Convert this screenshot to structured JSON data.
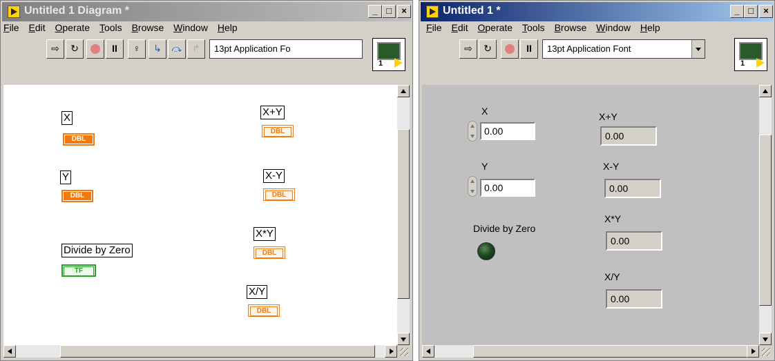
{
  "diagram_window": {
    "title": "Untitled 1 Diagram *",
    "menu": [
      "File",
      "Edit",
      "Operate",
      "Tools",
      "Browse",
      "Window",
      "Help"
    ],
    "font": "13pt Application Fo",
    "icon_number": "1",
    "controls": [
      {
        "label": "X",
        "type": "DBL"
      },
      {
        "label": "Y",
        "type": "DBL"
      },
      {
        "label": "Divide by Zero",
        "type": "TF"
      }
    ],
    "indicators": [
      {
        "label": "X+Y",
        "type": "DBL"
      },
      {
        "label": "X-Y",
        "type": "DBL"
      },
      {
        "label": "X*Y",
        "type": "DBL"
      },
      {
        "label": "X/Y",
        "type": "DBL"
      }
    ]
  },
  "panel_window": {
    "title": "Untitled 1 *",
    "menu": [
      "File",
      "Edit",
      "Operate",
      "Tools",
      "Browse",
      "Window",
      "Help"
    ],
    "font": "13pt Application Font",
    "icon_number": "1",
    "controls": [
      {
        "label": "X",
        "value": "0.00"
      },
      {
        "label": "Y",
        "value": "0.00"
      }
    ],
    "led_label": "Divide by Zero",
    "indicators": [
      {
        "label": "X+Y",
        "value": "0.00"
      },
      {
        "label": "X-Y",
        "value": "0.00"
      },
      {
        "label": "X*Y",
        "value": "0.00"
      },
      {
        "label": "X/Y",
        "value": "0.00"
      }
    ]
  },
  "colors": {
    "panel_bg": "#c0c0c0",
    "diagram_bg": "#ffffff",
    "dbl_terminal": "#f07a10",
    "bool_terminal": "#2a9a2a",
    "led_off": "#1e4a1e"
  },
  "toolbar_icons": {
    "diagram": [
      "run-arrow-icon",
      "run-continuous-icon",
      "abort-icon",
      "pause-icon",
      "highlight-execution-icon",
      "step-into-icon",
      "step-over-icon",
      "step-out-icon"
    ],
    "panel": [
      "run-arrow-icon",
      "run-continuous-icon",
      "abort-icon",
      "pause-icon"
    ]
  }
}
